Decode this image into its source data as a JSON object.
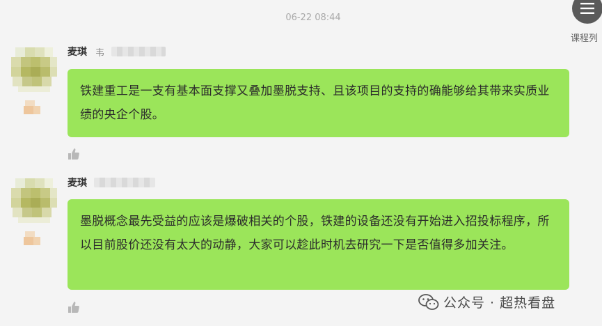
{
  "timestamp": "06-22 08:44",
  "course_button": {
    "label": "课程列",
    "icon": "list-icon"
  },
  "messages": [
    {
      "sender": "麦琪",
      "sender_tag": "韦",
      "text": "铁建重工是一支有基本面支撑又叠加墨脱支持、且该项目的支持的确能够给其带来实质业绩的央企个股。",
      "like_icon": "thumbs-up-icon"
    },
    {
      "sender": "麦琪",
      "sender_tag": "",
      "text": "墨脱概念最先受益的应该是爆破相关的个股，铁建的设备还没有开始进入招投标程序，所以目前股价还没有太大的动静，大家可以趁此时机去研究一下是否值得多加关注。",
      "like_icon": "thumbs-up-icon"
    }
  ],
  "watermark": {
    "text": "公众号 · 超热看盘",
    "icon": "wechat-icon"
  },
  "colors": {
    "background": "#f4f4f4",
    "bubble": "#9be55a",
    "timestamp": "#a9a9a9"
  }
}
